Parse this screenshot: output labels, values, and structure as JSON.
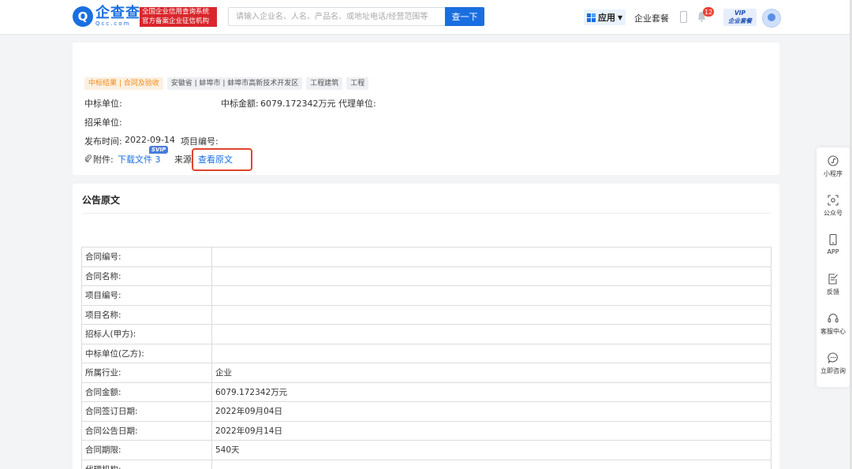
{
  "header": {
    "logo_mark": "Q",
    "logo_name": "企查查",
    "logo_domain": "Qcc.com",
    "slogan_line1": "全国企业信用查询系统",
    "slogan_line2": "官方备案企业征信机构",
    "search_placeholder": "请输入企业名、人名、产品名、或地址电话/经营范围等",
    "search_button": "查一下",
    "app_label": "应用",
    "package_label": "企业套餐",
    "notification_count": "12",
    "vip_line1": "VIP",
    "vip_line2": "企业套餐"
  },
  "info": {
    "tags": [
      "中标结果 | 合同及验收",
      "安徽省 | 蚌埠市 | 蚌埠市高新技术开发区",
      "工程建筑",
      "工程"
    ],
    "winner_label": "中标单位:",
    "amount_label": "中标金额:",
    "amount_value": "6079.172342万元",
    "agent_label": "代理单位:",
    "purchaser_label": "招采单位:",
    "publish_label": "发布时间:",
    "publish_value": "2022-09-14",
    "project_no_label": "项目编号:",
    "attachment_label": "附件:",
    "download_label": "下载文件 3",
    "svip_label": "SVIP",
    "source_label": "来源",
    "view_original_label": "查看原文"
  },
  "announcement": {
    "title": "公告原文",
    "rows": [
      {
        "key": "合同编号:",
        "value": ""
      },
      {
        "key": "合同名称:",
        "value": ""
      },
      {
        "key": "项目编号:",
        "value": ""
      },
      {
        "key": "项目名称:",
        "value": ""
      },
      {
        "key": "招标人(甲方):",
        "value": ""
      },
      {
        "key": "中标单位(乙方):",
        "value": ""
      },
      {
        "key": "所属行业:",
        "value": "企业"
      },
      {
        "key": "合同金额:",
        "value": "6079.172342万元"
      },
      {
        "key": "合同签订日期:",
        "value": "2022年09月04日"
      },
      {
        "key": "合同公告日期:",
        "value": "2022年09月14日"
      },
      {
        "key": "合同期限:",
        "value": "540天"
      },
      {
        "key": "代理机构:",
        "value": ""
      }
    ]
  },
  "sidebar": {
    "items": [
      {
        "label": "小程序",
        "icon": "mini-program-icon"
      },
      {
        "label": "公众号",
        "icon": "official-account-icon"
      },
      {
        "label": "APP",
        "icon": "mobile-app-icon"
      },
      {
        "label": "反馈",
        "icon": "feedback-icon"
      },
      {
        "label": "客服中心",
        "icon": "headset-icon"
      },
      {
        "label": "立即咨询",
        "icon": "chat-icon"
      }
    ]
  },
  "colors": {
    "brand_blue": "#1a6fe0",
    "slogan_red": "#d9262c",
    "highlight_box": "#e0452d",
    "tag_orange": "#f08a1a"
  }
}
